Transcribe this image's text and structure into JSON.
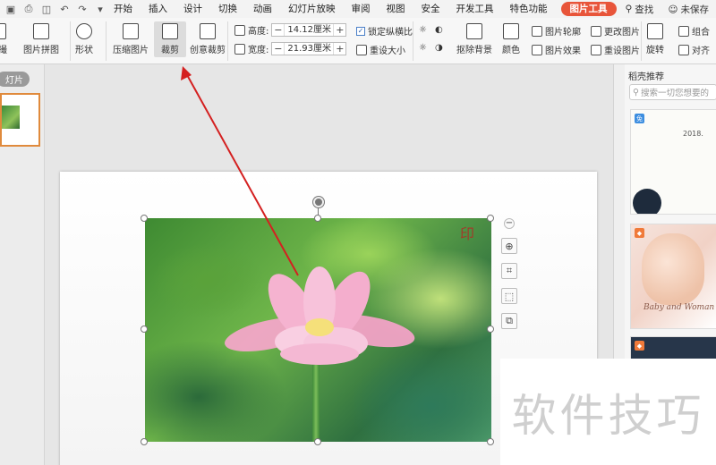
{
  "menubar": {
    "menus": [
      "开始",
      "插入",
      "设计",
      "切换",
      "动画",
      "幻灯片放映",
      "审阅",
      "视图",
      "安全",
      "开发工具",
      "特色功能",
      "图片工具"
    ],
    "active_menu": "图片工具",
    "search_label": "查找",
    "unsaved_label": "未保存"
  },
  "ribbon": {
    "left_cut_label": "抠撮",
    "collage_label": "图片拼图",
    "shape_label": "形状",
    "compress_label": "压缩图片",
    "crop_label": "裁剪",
    "creative_crop_label": "创意裁剪",
    "height_label": "高度:",
    "height_value": "14.12厘米",
    "width_label": "宽度:",
    "width_value": "21.93厘米",
    "lock_ratio_label": "锁定纵横比",
    "reset_size_label": "重设大小",
    "remove_bg_label": "抠除背景",
    "color_label": "颜色",
    "outline_label": "图片轮廓",
    "effect_label": "图片效果",
    "change_label": "更改图片",
    "reset_label": "重设图片",
    "rotate_label": "旋转",
    "combine_label": "组合",
    "align_label": "对齐"
  },
  "left_panel": {
    "tab_label": "灯片",
    "slide_number": "1"
  },
  "right_panel": {
    "title": "稻壳推荐",
    "search_placeholder": "搜索一切您想要的",
    "card1_text": "2018.",
    "card2_text": "Baby and Woman"
  },
  "watermark": "软件技巧",
  "colors": {
    "accent": "#e8553a",
    "arrow": "#d42020"
  }
}
